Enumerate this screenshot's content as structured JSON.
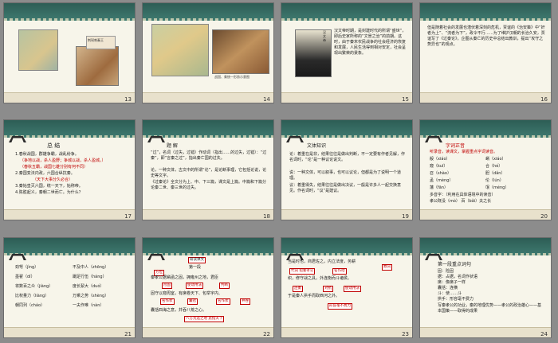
{
  "slides": [
    {
      "number": "13",
      "caption": "荆轲刺秦王"
    },
    {
      "number": "14",
      "caption": "战国、秦统一形势示意图"
    },
    {
      "number": "15",
      "text": "汉文帝时期，是封建时代的所谓“盛世”，即后史家所称的“文景之治”的前期。这时，由于秦末农民战争的社会经济的恢复和发展，人民生活得到相对安定，社会呈现出繁荣的景象。",
      "portrait_label": "汉文帝"
    },
    {
      "number": "16",
      "text": "但是随着社会的发展也潜伏着深刻的危机，贾谊的《治安策》中“奸者为上”、“流者为下”，政令不行……为了维护汉朝的长治久安，贾谊写了《过秦论》，企图从秦亡的历史中总结出教训，提出“攻守之势异也”的观点。"
    },
    {
      "number": "17",
      "title": "总  结",
      "lines": [
        "1.春秋战国，群雄争霸，战乱纷争。",
        "（争地以战，杀人盈野；争城以战，杀人盈城。）",
        "（春秋五霸，战国七雄分别有何不同）",
        "2.秦国变法内政，六国合纵抗秦。",
        "（天下大事分久必合）",
        "3.秦始皇灭六国，统一天下，始称帝。",
        "4.陈胜起义，秦朝二世而亡。为什么？"
      ]
    },
    {
      "number": "18",
      "title": "题  解",
      "lines": [
        "“过”，名词（过失，过错）作动词（指出……的过失，过错）：“过秦”，即“言秦之过”，指出秦亡国的过失。",
        "论，一种文体，古文中的所谓“论”，是论断事理，它包括论说，论史等文字。",
        "《过秦论》全文分为上、中、下三篇，课文是上篇。中篇和下篇分论秦二世、秦三世的过失。"
      ]
    },
    {
      "number": "19",
      "title": "文体知识",
      "lines": [
        "论：着重在是非，结果往往是做出判断，不一定要有作者见解，作名词时，“论”是一种议论说文。",
        "说：一种文体，可以叙事，也可以议论，但都是为了说明一个道理。",
        "议：着重得失，结果往往是做出决议，一般是许多人一起交换意见。作名词时，“议”是建议。"
      ]
    },
    {
      "number": "20",
      "title": "字词正音",
      "subtitle": "听录音，读课文，掌握重点字词读音。",
      "pairs": [
        [
          "殽",
          "xiáo"
        ],
        [
          "崤",
          "xiáo"
        ],
        [
          "窥",
          "kuī"
        ],
        [
          "合",
          "hé"
        ],
        [
          "召",
          "shào"
        ],
        [
          "胆",
          "dǎn"
        ],
        [
          "孟",
          "mèng"
        ],
        [
          "伦",
          "lún"
        ],
        [
          "藩",
          "fān"
        ],
        [
          "氓",
          "méng"
        ],
        [
          "镝",
          "dí"
        ],
        [
          "窥",
          "kuì"
        ]
      ],
      "extra": [
        "多音字：（利用在具体语境中的读音）",
        "孝公既没（mò）",
        "百（bǎi）夫之长",
        "阡陌("
      ]
    },
    {
      "number": "21",
      "lines": [
        [
          "劲弩（jìng）",
          "不及中人（zhōng）"
        ],
        [
          "墨翟（dí）",
          "蹑足行伍（háng）"
        ],
        [
          "将数百之众（jiàng）",
          "度长絜大（duó）"
        ],
        [
          "比权量力（liàng）",
          "万乘之势（shèng）"
        ],
        [
          "朝同列（cháo）",
          "一夫作难（nàn）"
        ]
      ]
    },
    {
      "number": "22",
      "title": "研读课文",
      "paragraph": "第一段",
      "lines": [
        "秦孝公据崤函之固，拥雍州之地，君臣",
        "固守以窥周室，有席卷天下、包举宇内、",
        "囊括四海之意，并吞八荒之心。"
      ],
      "tags": [
        "方位",
        "险固",
        "使动用法",
        "判断",
        "名作状",
        "囊括",
        "名作状",
        "并吞",
        "八方荒远之地  此指天下"
      ]
    },
    {
      "number": "23",
      "lines": [
        "当是时也，商君佐之，内立法度，务耕",
        "织，修守战之具，外连衡而斗诸侯。",
        "于是秦人拱手而取西河之外。"
      ],
      "tags": [
        "代词  指秦孝公",
        "名作动",
        "数词",
        "连衡",
        "对抗",
        "使动用法",
        "形容毫不费力"
      ]
    },
    {
      "number": "24",
      "title": "第一段重点词句",
      "lines": [
        "固：险固",
        "据：占据，名词作状语",
        "席：像席子一样",
        "囊括：连横",
        "斗：使……斗",
        "拱手：形容毫不费力"
      ],
      "summary": "写秦孝公的功业，秦的地理优势——孝公的政治雄心——基本国策——取得的成果"
    }
  ]
}
